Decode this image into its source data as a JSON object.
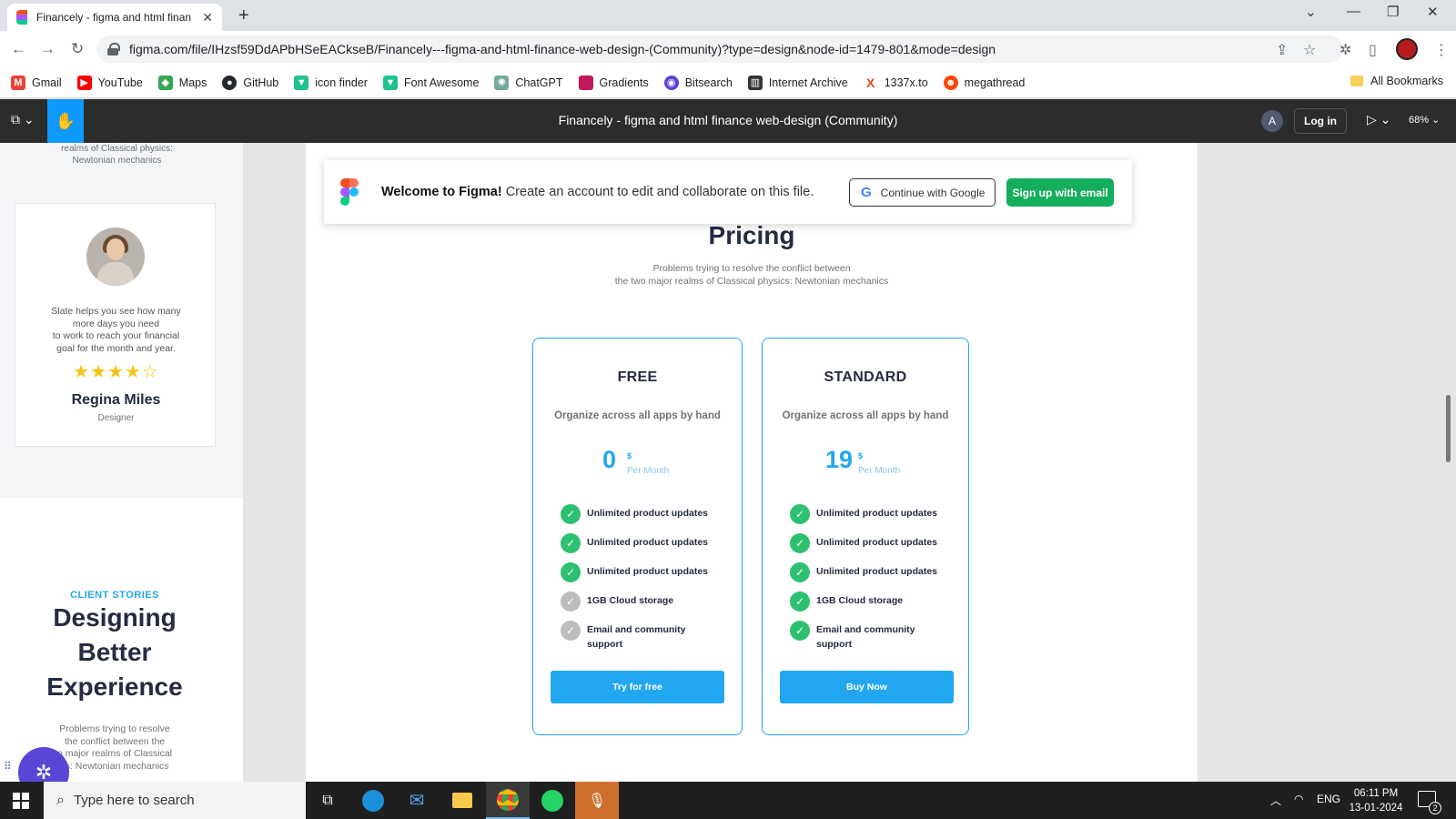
{
  "browser": {
    "tab_title": "Financely - figma and html finan",
    "url": "figma.com/file/IHzsf59DdAPbHSeEACkseB/Financely---figma-and-html-finance-web-design-(Community)?type=design&node-id=1479-801&mode=design",
    "bookmarks": [
      {
        "label": "Gmail",
        "icon": "gmail-icon",
        "color": "#ea4335"
      },
      {
        "label": "YouTube",
        "icon": "youtube-icon",
        "color": "#ff0000"
      },
      {
        "label": "Maps",
        "icon": "maps-icon",
        "color": "#34a853"
      },
      {
        "label": "GitHub",
        "icon": "github-icon",
        "color": "#24292e"
      },
      {
        "label": "icon finder",
        "icon": "iconfinder-icon",
        "color": "#1ec28b"
      },
      {
        "label": "Font Awesome",
        "icon": "fontawesome-icon",
        "color": "#1ec28b"
      },
      {
        "label": "ChatGPT",
        "icon": "chatgpt-icon",
        "color": "#74aa9c"
      },
      {
        "label": "Gradients",
        "icon": "gradients-icon",
        "color": "#c2185b"
      },
      {
        "label": "Bitsearch",
        "icon": "bitsearch-icon",
        "color": "#5b3fd6"
      },
      {
        "label": "Internet Archive",
        "icon": "archive-icon",
        "color": "#333333"
      },
      {
        "label": "1337x.to",
        "icon": "x-icon",
        "color": "#e04a1d"
      },
      {
        "label": "megathread",
        "icon": "reddit-icon",
        "color": "#ff4500"
      }
    ],
    "all_bookmarks": "All Bookmarks"
  },
  "figma": {
    "file_title": "Financely - figma and html finance web-design (Community)",
    "avatar_letter": "A",
    "login_label": "Log in",
    "zoom": "68%",
    "welcome": {
      "bold": "Welcome to Figma!",
      "text": " Create an account to edit and collaborate on this file.",
      "google_label": "Continue with Google",
      "signup_label": "Sign up with email"
    }
  },
  "left_frame": {
    "top_text_lines": [
      "realms of Classical physics:",
      "Newtonian mechanics"
    ],
    "testimonial": {
      "quote_lines": [
        "Slate helps you see how many",
        "more days you need",
        "to work to reach your financial",
        "goal for the month and year."
      ],
      "stars": "★★★★☆",
      "rating": 4,
      "name": "Regina Miles",
      "role": "Designer"
    },
    "client_stories": {
      "label": "CLIENT STORIES",
      "title_lines": [
        "Designing",
        "Better",
        "Experience"
      ],
      "text_lines": [
        "Problems trying to resolve",
        "the conflict between the",
        "o major realms of Classical",
        "cs: Newtonian mechanics"
      ]
    }
  },
  "pricing": {
    "title": "Pricing",
    "subtitle_lines": [
      "Problems trying to resolve the conflict between",
      "the two major realms of Classical physics: Newtonian mechanics"
    ],
    "plans": [
      {
        "name": "FREE",
        "description": "Organize across all apps by hand",
        "price": "0",
        "currency": "$",
        "period": "Per Month",
        "features": [
          {
            "text": "Unlimited product updates",
            "included": true
          },
          {
            "text": "Unlimited product updates",
            "included": true
          },
          {
            "text": "Unlimited product updates",
            "included": true
          },
          {
            "text": "1GB  Cloud storage",
            "included": false
          },
          {
            "text": "Email and community support",
            "included": false
          }
        ],
        "button": "Try for free"
      },
      {
        "name": "STANDARD",
        "description": "Organize across all apps by hand",
        "price": "19",
        "currency": "$",
        "period": "Per Month",
        "features": [
          {
            "text": "Unlimited product updates",
            "included": true
          },
          {
            "text": "Unlimited product updates",
            "included": true
          },
          {
            "text": "Unlimited product updates",
            "included": true
          },
          {
            "text": "1GB  Cloud storage",
            "included": true
          },
          {
            "text": "Email and community support",
            "included": true
          }
        ],
        "button": "Buy Now"
      }
    ]
  },
  "taskbar": {
    "search_placeholder": "Type here to search",
    "language": "ENG",
    "time": "06:11 PM",
    "date": "13-01-2024",
    "notifications": "2"
  },
  "colors": {
    "accent": "#23a6f0",
    "check_on": "#2dc071",
    "check_off": "#bdbdbd",
    "figma_green": "#14ae5c"
  }
}
